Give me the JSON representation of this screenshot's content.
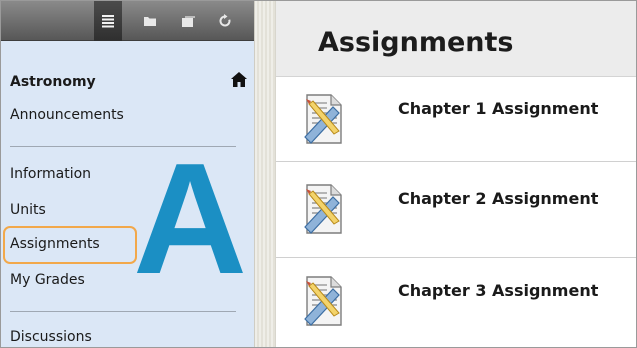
{
  "toolbar": {
    "icons": [
      "list-icon",
      "folder-icon",
      "window-icon",
      "refresh-icon"
    ]
  },
  "sidebar": {
    "course_title": "Astronomy",
    "items": [
      {
        "label": "Announcements"
      },
      {
        "label": "Information"
      },
      {
        "label": "Units"
      },
      {
        "label": "Assignments"
      },
      {
        "label": "My Grades"
      },
      {
        "label": "Discussions"
      }
    ],
    "overlay_letter": "A"
  },
  "main": {
    "title": "Assignments",
    "items": [
      {
        "title": "Chapter 1 Assignment",
        "icon": "assignment-icon"
      },
      {
        "title": "Chapter 2 Assignment",
        "icon": "assignment-icon"
      },
      {
        "title": "Chapter 3 Assignment",
        "icon": "assignment-icon"
      }
    ]
  },
  "colors": {
    "sidebar_bg": "#dbe7f6",
    "highlight": "#f2a84a",
    "overlay_letter": "#1b8fc4"
  }
}
